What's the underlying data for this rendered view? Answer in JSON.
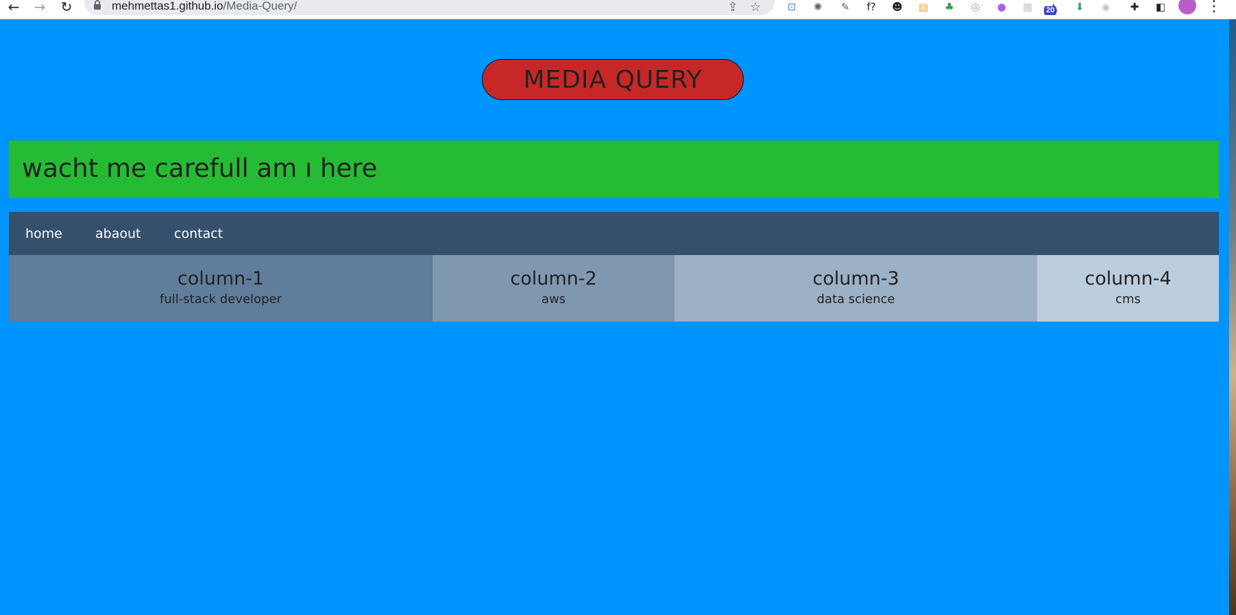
{
  "browser": {
    "url_host": "mehmettas1.github.io",
    "url_path": "/Media-Query/",
    "buttons": {
      "back": "←",
      "forward": "→",
      "reload": "↻",
      "share": "⇪",
      "bookmark": "☆"
    },
    "extensions": [
      {
        "name": "translate-icon",
        "glyph": "⊡",
        "color": "#4285f4"
      },
      {
        "name": "bug-icon",
        "glyph": "✺",
        "color": "#5f6368"
      },
      {
        "name": "eyedropper-icon",
        "glyph": "✎",
        "color": "#5f6368"
      },
      {
        "name": "font-icon",
        "glyph": "f?",
        "color": "#202124"
      },
      {
        "name": "mustache-icon",
        "glyph": "☻",
        "color": "#202124"
      },
      {
        "name": "note-icon",
        "glyph": "▤",
        "color": "#e8a33b"
      },
      {
        "name": "tree-icon",
        "glyph": "♣",
        "color": "#2e9e44"
      },
      {
        "name": "compass-icon",
        "glyph": "◎",
        "color": "#9aa0a6"
      },
      {
        "name": "rhino-icon",
        "glyph": "●",
        "color": "#b15ee0"
      },
      {
        "name": "grid-icon",
        "glyph": "▦",
        "color": "#c7c7c7"
      },
      {
        "name": "hat-icon",
        "glyph": "▲",
        "color": "#3b43c4"
      },
      {
        "name": "download-icon",
        "glyph": "⬇",
        "color": "#34a853"
      },
      {
        "name": "target-icon",
        "glyph": "◉",
        "color": "#c7c7c7"
      },
      {
        "name": "puzzle-icon",
        "glyph": "✚",
        "color": "#202124"
      },
      {
        "name": "sidepanel-icon",
        "glyph": "◧",
        "color": "#202124"
      }
    ],
    "ext_badge": "20",
    "menu": "⋮"
  },
  "page": {
    "title": "MEDIA QUERY",
    "banner": "wacht me carefull am ı here",
    "nav": [
      "home",
      "abaout",
      "contact"
    ],
    "columns": [
      {
        "title": "column-1",
        "subtitle": "full-stack developer",
        "color": "#607d9b"
      },
      {
        "title": "column-2",
        "subtitle": "aws",
        "color": "#7f98b0"
      },
      {
        "title": "column-3",
        "subtitle": "data science",
        "color": "#9cb0c6"
      },
      {
        "title": "column-4",
        "subtitle": "cms",
        "color": "#bccddd"
      }
    ]
  },
  "colors": {
    "page_background": "#0094ff",
    "title_background": "#c62828",
    "banner_background": "#26bb34",
    "navbar_background": "#34506d"
  }
}
